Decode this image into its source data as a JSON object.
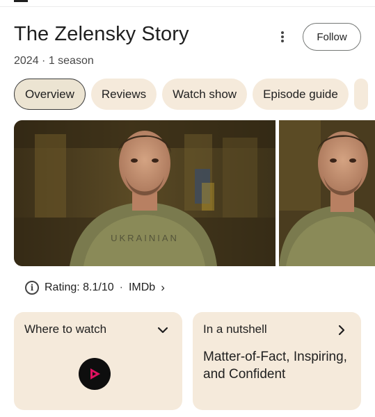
{
  "header": {
    "title": "The Zelensky Story",
    "subtitle": "2024 · 1 season",
    "follow_label": "Follow",
    "more_icon": "more-vert-icon"
  },
  "tabs": [
    {
      "label": "Overview",
      "active": true
    },
    {
      "label": "Reviews",
      "active": false
    },
    {
      "label": "Watch show",
      "active": false
    },
    {
      "label": "Episode guide",
      "active": false
    }
  ],
  "media": {
    "shirt_text": "UKRAINIAN"
  },
  "rating": {
    "label": "Rating: 8.1/10",
    "separator": "·",
    "source": "IMDb",
    "chevron": "›"
  },
  "cards": {
    "where_to_watch": {
      "title": "Where to watch",
      "icon": "chevron-down-icon"
    },
    "nutshell": {
      "title": "In a nutshell",
      "body": "Matter-of-Fact, Inspiring, and Confident",
      "icon": "chevron-right-icon"
    }
  },
  "colors": {
    "chip_bg": "#f5eadb",
    "provider_accent": "#e0115f"
  }
}
